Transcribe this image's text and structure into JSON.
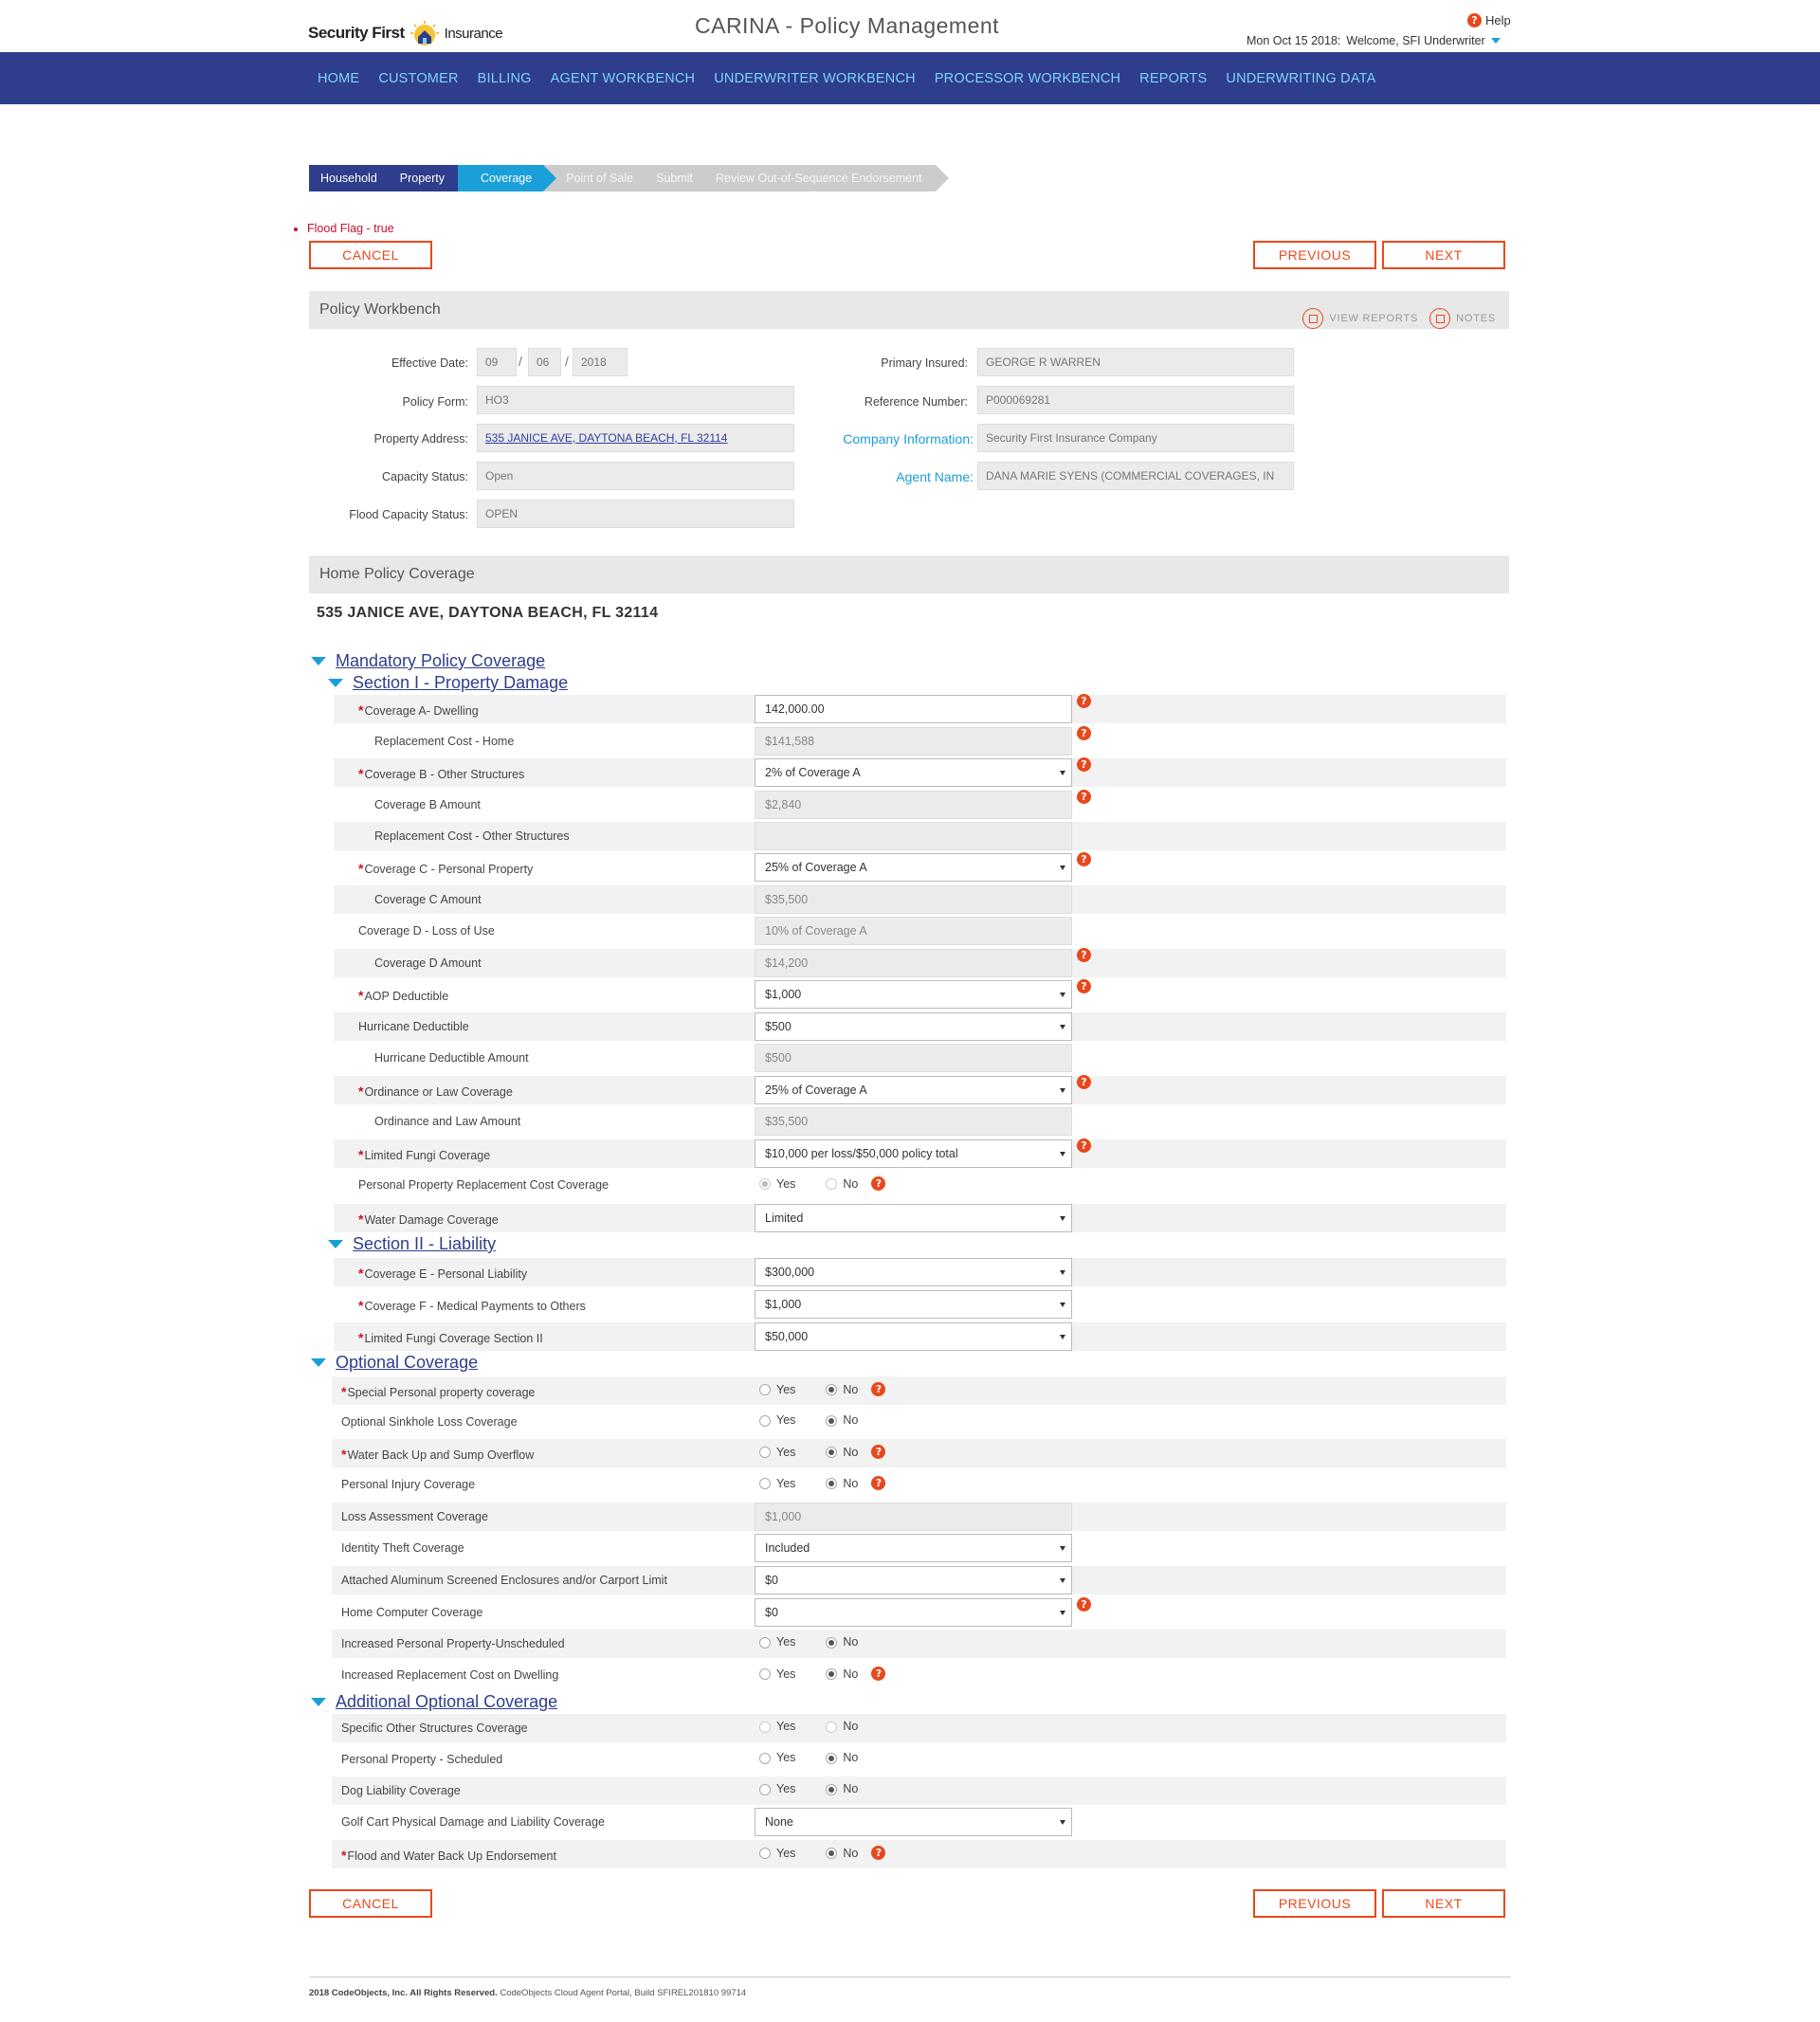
{
  "header": {
    "logo_text_1": "Security First",
    "logo_text_2": "Insurance",
    "app_title": "CARINA - Policy Management",
    "help_label": "Help",
    "date_text": "Mon Oct 15 2018:",
    "welcome_text": "Welcome, SFI Underwriter",
    "accent_color": "#1a9fd9",
    "nav_bg": "#2e3e8c"
  },
  "nav": [
    "HOME",
    "CUSTOMER",
    "BILLING",
    "AGENT WORKBENCH",
    "UNDERWRITER WORKBENCH",
    "PROCESSOR WORKBENCH",
    "REPORTS",
    "UNDERWRITING DATA"
  ],
  "steps": [
    "Household",
    "Property",
    "Coverage",
    "Point of Sale",
    "Submit",
    "Review Out-of-Sequence Endorsement"
  ],
  "alert": "Flood Flag - true",
  "buttons": {
    "cancel": "CANCEL",
    "previous": "PREVIOUS",
    "next": "NEXT"
  },
  "workbench": {
    "title": "Policy Workbench",
    "view_reports": "VIEW REPORTS",
    "notes": "NOTES",
    "effective_date_label": "Effective Date:",
    "eff_mm": "09",
    "eff_dd": "06",
    "eff_yyyy": "2018",
    "policy_form_label": "Policy Form:",
    "policy_form": "HO3",
    "property_address_label": "Property Address:",
    "property_address": "535 JANICE AVE, DAYTONA BEACH, FL 32114",
    "capacity_status_label": "Capacity Status:",
    "capacity_status": "Open",
    "flood_capacity_label": "Flood Capacity Status:",
    "flood_capacity": "OPEN",
    "primary_insured_label": "Primary Insured:",
    "primary_insured": "GEORGE R WARREN",
    "reference_number_label": "Reference Number:",
    "reference_number": "P000069281",
    "company_info_label": "Company Information:",
    "company_info": "Security First Insurance Company",
    "agent_name_label": "Agent Name:",
    "agent_name": "DANA MARIE SYENS (COMMERCIAL COVERAGES, IN"
  },
  "coverage": {
    "title": "Home Policy Coverage",
    "address": "535 JANICE AVE, DAYTONA BEACH, FL 32114",
    "mandatory": "Mandatory Policy Coverage",
    "section1": "Section I - Property Damage",
    "section2": "Section II - Liability",
    "optional": "Optional Coverage",
    "additional": "Additional Optional Coverage",
    "yes": "Yes",
    "no": "No",
    "rows": [
      {
        "label": "Coverage A- Dwelling",
        "value": "142,000.00"
      },
      {
        "label": "Replacement Cost - Home",
        "value": "$141,588"
      },
      {
        "label": "Coverage B - Other Structures",
        "value": "2% of Coverage A"
      },
      {
        "label": "Coverage B Amount",
        "value": "$2,840"
      },
      {
        "label": "Replacement Cost - Other Structures",
        "value": ""
      },
      {
        "label": "Coverage C - Personal Property",
        "value": "25% of Coverage A"
      },
      {
        "label": "Coverage C Amount",
        "value": "$35,500"
      },
      {
        "label": "Coverage D - Loss of Use",
        "value": "10% of Coverage A"
      },
      {
        "label": "Coverage D Amount",
        "value": "$14,200"
      },
      {
        "label": "AOP Deductible",
        "value": "$1,000"
      },
      {
        "label": "Hurricane Deductible",
        "value": "$500"
      },
      {
        "label": "Hurricane Deductible Amount",
        "value": "$500"
      },
      {
        "label": "Ordinance or Law Coverage",
        "value": "25% of Coverage A"
      },
      {
        "label": "Ordinance and Law Amount",
        "value": "$35,500"
      },
      {
        "label": "Limited Fungi Coverage",
        "value": "$10,000 per loss/$50,000 policy total"
      },
      {
        "label": "Personal Property Replacement Cost Coverage",
        "value": "Yes"
      },
      {
        "label": "Water Damage Coverage",
        "value": "Limited"
      },
      {
        "label": "Coverage E - Personal Liability",
        "value": "$300,000"
      },
      {
        "label": "Coverage F - Medical Payments to Others",
        "value": "$1,000"
      },
      {
        "label": "Limited Fungi Coverage Section II",
        "value": "$50,000"
      },
      {
        "label": "Special Personal property coverage",
        "value": "No"
      },
      {
        "label": "Optional Sinkhole Loss Coverage",
        "value": "No"
      },
      {
        "label": "Water Back Up and Sump Overflow",
        "value": "No"
      },
      {
        "label": "Personal Injury Coverage",
        "value": "No"
      },
      {
        "label": "Loss Assessment Coverage",
        "value": "$1,000"
      },
      {
        "label": "Identity Theft Coverage",
        "value": "Included"
      },
      {
        "label": "Attached Aluminum Screened Enclosures and/or Carport Limit",
        "value": "$0"
      },
      {
        "label": "Home Computer Coverage",
        "value": "$0"
      },
      {
        "label": "Increased Personal Property-Unscheduled",
        "value": "No"
      },
      {
        "label": "Increased Replacement Cost on Dwelling",
        "value": "No"
      },
      {
        "label": "Specific Other Structures Coverage",
        "value": ""
      },
      {
        "label": "Personal Property - Scheduled",
        "value": "No"
      },
      {
        "label": "Dog Liability Coverage",
        "value": "No"
      },
      {
        "label": "Golf Cart Physical Damage and Liability Coverage",
        "value": "None"
      },
      {
        "label": "Flood and Water Back Up Endorsement",
        "value": "No"
      }
    ]
  },
  "footer": {
    "copyright": "2018 CodeObjects, Inc. All Rights Reserved.",
    "build": "CodeObjects Cloud Agent Portal, Build SFIREL201810 99714"
  }
}
